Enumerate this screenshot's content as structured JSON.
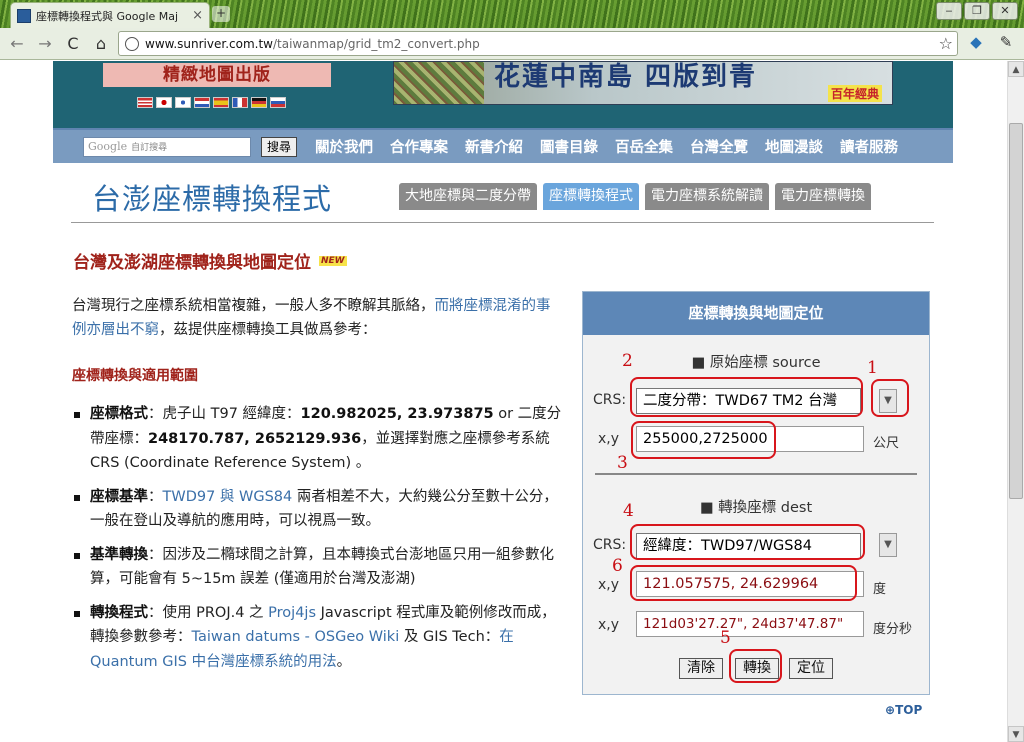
{
  "browser": {
    "tab_title": "座標轉換程式與 Google Maj",
    "tab_close": "×",
    "new_tab": "+",
    "url_host": "www.sunriver.com.tw",
    "url_path": "/taiwanmap/grid_tm2_convert.php",
    "win_min": "‒",
    "win_max": "❐",
    "win_close": "✕",
    "back": "←",
    "forward": "→",
    "reload": "C",
    "home": "⌂",
    "star": "☆"
  },
  "header": {
    "publisher_banner": "精緻地圖出版",
    "flags": [
      "#cc3b3b",
      "#ffffff",
      "#ffffff",
      "#2f5bb7",
      "#e8c31a",
      "#2f5bb7",
      "#111111",
      "#ffffff"
    ],
    "ad_text": "花蓮中南島 四版到青",
    "ad_badge": "百年經典"
  },
  "menu": {
    "search_logo": "Google",
    "search_placeholder": "自訂搜尋",
    "search_button": "搜尋",
    "items": [
      "關於我們",
      "合作專案",
      "新書介紹",
      "圖書目錄",
      "百岳全集",
      "台灣全覽",
      "地圖漫談",
      "讀者服務"
    ]
  },
  "page": {
    "title": "台澎座標轉換程式",
    "tabs": [
      "大地座標與二度分帶",
      "座標轉換程式",
      "電力座標系統解讀",
      "電力座標轉換"
    ],
    "active_tab": 1,
    "heading": "台灣及澎湖座標轉換與地圖定位",
    "new_badge": "NEW",
    "intro_text": "台灣現行之座標系統相當複雜，一般人多不瞭解其脈絡，",
    "intro_link": "而將座標混淆的事例亦層出不窮",
    "intro_text2": "，茲提供座標轉換工具做爲參考：",
    "sub_heading": "座標轉換與適用範圍",
    "bullet1_bold": "座標格式",
    "bullet1_text": "：虎子山 T97 經緯度：",
    "bullet1_value": "120.982025, 23.973875",
    "bullet1_text2": " or 二度分帶座標：",
    "bullet1_value2": "248170.787, 2652129.936",
    "bullet1_text3": "，並選擇對應之座標參考系統 CRS (Coordinate Reference System) 。",
    "bullet2_bold": "座標基準",
    "bullet2_text": "：",
    "bullet2_link": "TWD97 與 WGS84",
    "bullet2_text2": " 兩者相差不大，大約幾公分至數十公分，一般在登山及導航的應用時，可以視爲一致。",
    "bullet3_bold": "基準轉換",
    "bullet3_text": "：因涉及二橢球間之計算，且本轉換式台澎地區只用一組參數化算，可能會有 5~15m 誤差 (僅適用於台灣及澎湖)",
    "bullet4_bold": "轉換程式",
    "bullet4_text": "：使用 PROJ.4 之 ",
    "bullet4_link1": "Proj4js",
    "bullet4_text2": " Javascript 程式庫及範例修改而成，轉換參數參考：",
    "bullet4_link2": "Taiwan datums - OSGeo Wiki",
    "bullet4_text3": " 及 GIS Tech：",
    "bullet4_link3": "在 Quantum GIS 中台灣座標系統的用法",
    "bullet4_text4": "。",
    "top_link": "TOP"
  },
  "converter": {
    "header": "座標轉換與地圖定位",
    "source_title": "■ 原始座標 source",
    "crs_label": "CRS:",
    "xy_label": "x,y",
    "source_crs": "二度分帶：TWD67 TM2 台灣",
    "source_xy": "255000,2725000",
    "source_unit": "公尺",
    "dest_title": "■ 轉換座標 dest",
    "dest_crs": "經緯度：TWD97/WGS84",
    "dest_xy_deg": "121.057575, 24.629964",
    "dest_unit_deg": "度",
    "dest_xy_dms": "121d03'27.27\", 24d37'47.87\"",
    "dest_unit_dms": "度分秒",
    "btn_clear": "清除",
    "btn_convert": "轉換",
    "btn_locate": "定位",
    "dropdown_arrow": "▼"
  },
  "annotations": [
    "1",
    "2",
    "3",
    "4",
    "5",
    "6"
  ]
}
